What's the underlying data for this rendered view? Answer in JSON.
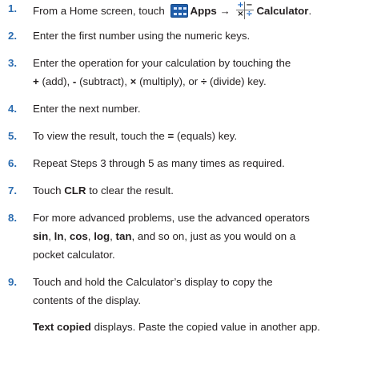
{
  "steps": [
    {
      "number": "1.",
      "line1": {
        "pre": "From a Home screen, touch",
        "apps_label": "Apps",
        "arrow": "→",
        "calc_label": "Calculator",
        "post": "."
      }
    },
    {
      "number": "2.",
      "text": "Enter the first number using the numeric keys."
    },
    {
      "number": "3.",
      "line1": "Enter the operation for your calculation by touching the",
      "line2": {
        "plus": "+",
        "add": "(add),",
        "minus": "-",
        "subtract": "(subtract),",
        "times": "×",
        "multiply": "(multiply), or",
        "divide_sym": "÷",
        "divide": "(divide) key."
      }
    },
    {
      "number": "4.",
      "text": "Enter the next number."
    },
    {
      "number": "5.",
      "pre": "To view the result, touch the",
      "equals": "=",
      "post": "(equals) key."
    },
    {
      "number": "6.",
      "text": "Repeat Steps 3 through 5 as many times as required."
    },
    {
      "number": "7.",
      "pre": "Touch",
      "clr": "CLR",
      "post": "to clear the result."
    },
    {
      "number": "8.",
      "line1": "For more advanced problems, use the advanced operators",
      "line2": {
        "sin": "sin",
        "ln": "ln",
        "cos": "cos",
        "log": "log",
        "tan": "tan",
        "comma": ",",
        "tail": "and so on, just as you would on a"
      },
      "line3": "pocket calculator."
    },
    {
      "number": "9.",
      "line1": "Touch and hold the Calculator’s display to copy the",
      "line2": "contents of the display.",
      "note_bold": "Text copied",
      "note_rest": "displays. Paste the copied value in another app."
    }
  ],
  "icons": {
    "apps": "apps-grid-icon",
    "calculator": "calculator-icon",
    "calc_symbols": [
      "+",
      "−",
      "×",
      "÷"
    ]
  },
  "colors": {
    "number": "#2b6cb0",
    "apps_icon": "#1f5da9",
    "text": "#231f20"
  }
}
